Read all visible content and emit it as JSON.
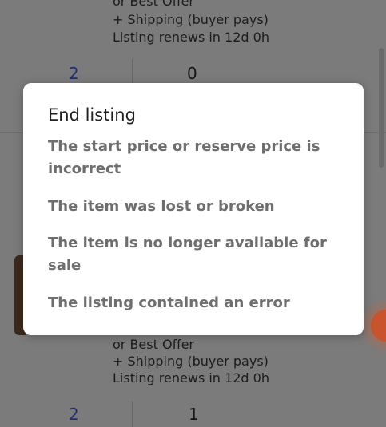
{
  "background": {
    "top_listing": {
      "offer_text": "or Best Offer",
      "shipping_text": "+ Shipping (buyer pays)",
      "renew_text": "Listing renews in 12d 0h",
      "count_left": "2",
      "count_right": "0"
    },
    "bottom_listing": {
      "offer_text": "or Best Offer",
      "shipping_text": "+ Shipping (buyer pays)",
      "renew_text": "Listing renews in 12d 0h",
      "count_left": "2",
      "count_right": "1"
    }
  },
  "dialog": {
    "title": "End listing",
    "options": [
      "The start price or reserve price is incorrect",
      "The item was lost or broken",
      "The item is no longer available for sale",
      "The listing contained an error"
    ]
  },
  "colors": {
    "count_blue": "#1f2f73",
    "accent_orange": "#c8532d",
    "option_gray": "#6e6e6e"
  }
}
